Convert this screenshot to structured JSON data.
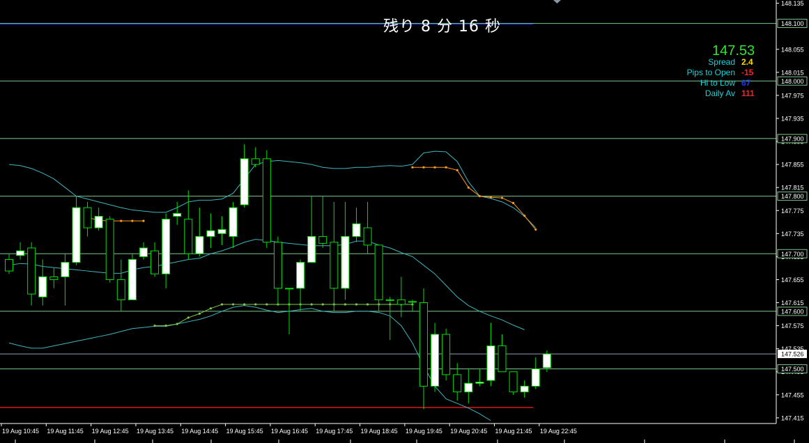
{
  "timer": {
    "text": "残り 8 分 16 秒"
  },
  "info_panel": {
    "price": "147.53",
    "rows": [
      {
        "label": "Spread",
        "value": "2.4",
        "color": "#ffd700"
      },
      {
        "label": "Pips to Open",
        "value": "-15",
        "color": "#ff2020"
      },
      {
        "label": "Hi to Low",
        "value": "67",
        "color": "#1a3cff"
      },
      {
        "label": "Daily Av",
        "value": "111",
        "color": "#ff2020"
      }
    ],
    "price_color": "#2fe52f",
    "label_color": "#18d4dc"
  },
  "chart_data": {
    "type": "candlestick",
    "timeframe_minutes": 15,
    "ylim": [
      147.41,
      148.137
    ],
    "y_ticks": [
      "148.135",
      "148.055",
      "148.015",
      "147.975",
      "147.935",
      "147.895",
      "147.855",
      "147.815",
      "147.775",
      "147.735",
      "147.695",
      "147.655",
      "147.615",
      "147.575",
      "147.535",
      "147.495",
      "147.455",
      "147.415"
    ],
    "x_labels": [
      "19 Aug 10:45",
      "19 Aug 11:45",
      "19 Aug 12:45",
      "19 Aug 13:45",
      "19 Aug 14:45",
      "19 Aug 15:45",
      "19 Aug 16:45",
      "19 Aug 17:45",
      "19 Aug 18:45",
      "19 Aug 19:45",
      "19 Aug 20:45",
      "19 Aug 21:45",
      "19 Aug 22:45"
    ],
    "horizontal_levels": [
      {
        "value": 148.1,
        "label": "148.100"
      },
      {
        "value": 148.0,
        "label": "148.000"
      },
      {
        "value": 147.9,
        "label": "147.900"
      },
      {
        "value": 147.8,
        "label": "147.800"
      },
      {
        "value": 147.7,
        "label": "147.700"
      },
      {
        "value": 147.6,
        "label": "147.600"
      },
      {
        "value": 147.5,
        "label": "147.500"
      }
    ],
    "current_price": {
      "value": 147.526,
      "label": "147.526"
    },
    "day_high": 148.1,
    "day_low": 147.433,
    "candles": [
      {
        "o": 147.69,
        "h": 147.7,
        "l": 147.665,
        "c": 147.67
      },
      {
        "o": 147.697,
        "h": 147.72,
        "l": 147.69,
        "c": 147.705
      },
      {
        "o": 147.71,
        "h": 147.72,
        "l": 147.61,
        "c": 147.63
      },
      {
        "o": 147.625,
        "h": 147.69,
        "l": 147.61,
        "c": 147.66
      },
      {
        "o": 147.66,
        "h": 147.675,
        "l": 147.64,
        "c": 147.655
      },
      {
        "o": 147.66,
        "h": 147.7,
        "l": 147.61,
        "c": 147.685
      },
      {
        "o": 147.685,
        "h": 147.8,
        "l": 147.68,
        "c": 147.78
      },
      {
        "o": 147.78,
        "h": 147.79,
        "l": 147.73,
        "c": 147.745
      },
      {
        "o": 147.745,
        "h": 147.78,
        "l": 147.74,
        "c": 147.765
      },
      {
        "o": 147.76,
        "h": 147.765,
        "l": 147.65,
        "c": 147.655
      },
      {
        "o": 147.655,
        "h": 147.69,
        "l": 147.6,
        "c": 147.62
      },
      {
        "o": 147.62,
        "h": 147.7,
        "l": 147.62,
        "c": 147.69
      },
      {
        "o": 147.695,
        "h": 147.72,
        "l": 147.69,
        "c": 147.71
      },
      {
        "o": 147.705,
        "h": 147.72,
        "l": 147.66,
        "c": 147.665
      },
      {
        "o": 147.665,
        "h": 147.77,
        "l": 147.64,
        "c": 147.76
      },
      {
        "o": 147.765,
        "h": 147.79,
        "l": 147.75,
        "c": 147.77
      },
      {
        "o": 147.76,
        "h": 147.81,
        "l": 147.69,
        "c": 147.7
      },
      {
        "o": 147.7,
        "h": 147.78,
        "l": 147.695,
        "c": 147.73
      },
      {
        "o": 147.73,
        "h": 147.77,
        "l": 147.71,
        "c": 147.74
      },
      {
        "o": 147.735,
        "h": 147.765,
        "l": 147.715,
        "c": 147.742
      },
      {
        "o": 147.73,
        "h": 147.79,
        "l": 147.71,
        "c": 147.78
      },
      {
        "o": 147.785,
        "h": 147.89,
        "l": 147.78,
        "c": 147.865
      },
      {
        "o": 147.865,
        "h": 147.885,
        "l": 147.85,
        "c": 147.855
      },
      {
        "o": 147.865,
        "h": 147.88,
        "l": 147.71,
        "c": 147.72
      },
      {
        "o": 147.72,
        "h": 147.73,
        "l": 147.61,
        "c": 147.64
      },
      {
        "o": 147.64,
        "h": 147.64,
        "l": 147.56,
        "c": 147.64
      },
      {
        "o": 147.64,
        "h": 147.69,
        "l": 147.6,
        "c": 147.685
      },
      {
        "o": 147.685,
        "h": 147.8,
        "l": 147.685,
        "c": 147.73
      },
      {
        "o": 147.73,
        "h": 147.8,
        "l": 147.71,
        "c": 147.718
      },
      {
        "o": 147.72,
        "h": 147.79,
        "l": 147.6,
        "c": 147.64
      },
      {
        "o": 147.64,
        "h": 147.79,
        "l": 147.62,
        "c": 147.73
      },
      {
        "o": 147.73,
        "h": 147.78,
        "l": 147.72,
        "c": 147.752
      },
      {
        "o": 147.745,
        "h": 147.79,
        "l": 147.7,
        "c": 147.715
      },
      {
        "o": 147.715,
        "h": 147.715,
        "l": 147.6,
        "c": 147.62
      },
      {
        "o": 147.62,
        "h": 147.625,
        "l": 147.55,
        "c": 147.62
      },
      {
        "o": 147.62,
        "h": 147.66,
        "l": 147.59,
        "c": 147.612
      },
      {
        "o": 147.617,
        "h": 147.62,
        "l": 147.6,
        "c": 147.617
      },
      {
        "o": 147.615,
        "h": 147.64,
        "l": 147.43,
        "c": 147.47
      },
      {
        "o": 147.47,
        "h": 147.58,
        "l": 147.46,
        "c": 147.56
      },
      {
        "o": 147.56,
        "h": 147.57,
        "l": 147.48,
        "c": 147.49
      },
      {
        "o": 147.49,
        "h": 147.51,
        "l": 147.445,
        "c": 147.46
      },
      {
        "o": 147.46,
        "h": 147.5,
        "l": 147.44,
        "c": 147.475
      },
      {
        "o": 147.475,
        "h": 147.5,
        "l": 147.47,
        "c": 147.477
      },
      {
        "o": 147.48,
        "h": 147.58,
        "l": 147.47,
        "c": 147.54
      },
      {
        "o": 147.54,
        "h": 147.56,
        "l": 147.5,
        "c": 147.495
      },
      {
        "o": 147.495,
        "h": 147.495,
        "l": 147.455,
        "c": 147.46
      },
      {
        "o": 147.46,
        "h": 147.48,
        "l": 147.45,
        "c": 147.47
      },
      {
        "o": 147.47,
        "h": 147.52,
        "l": 147.465,
        "c": 147.5
      },
      {
        "o": 147.502,
        "h": 147.532,
        "l": 147.495,
        "c": 147.526
      }
    ],
    "band_upper": [
      147.855,
      147.853,
      147.848,
      147.84,
      147.83,
      147.815,
      147.8,
      147.795,
      147.79,
      147.785,
      147.78,
      147.776,
      147.774,
      147.772,
      147.772,
      147.78,
      147.79,
      147.793,
      147.793,
      147.795,
      147.805,
      147.83,
      147.855,
      147.86,
      147.862,
      147.86,
      147.858,
      147.855,
      147.85,
      147.848,
      147.848,
      147.85,
      147.85,
      147.852,
      147.853,
      147.852,
      147.855,
      147.875,
      147.878,
      147.877,
      147.86,
      147.825,
      147.8,
      147.796,
      147.79,
      147.78,
      147.765,
      147.745,
      null
    ],
    "band_middle": [
      147.68,
      147.683,
      147.682,
      147.678,
      147.676,
      147.674,
      147.672,
      147.67,
      147.668,
      147.666,
      147.666,
      147.672,
      147.676,
      147.678,
      147.682,
      147.686,
      147.69,
      147.692,
      147.7,
      147.705,
      147.712,
      147.72,
      147.725,
      147.723,
      147.72,
      147.718,
      147.716,
      147.714,
      147.714,
      147.714,
      147.716,
      147.722,
      147.722,
      147.715,
      147.71,
      147.702,
      147.695,
      147.68,
      147.665,
      147.645,
      147.625,
      147.61,
      147.6,
      147.592,
      147.585,
      147.576,
      147.568,
      null,
      null
    ],
    "band_lower": [
      147.545,
      147.54,
      147.536,
      147.536,
      147.54,
      147.544,
      147.548,
      147.552,
      147.556,
      147.56,
      147.565,
      147.57,
      147.572,
      147.574,
      147.574,
      147.578,
      147.582,
      147.586,
      147.592,
      147.6,
      147.607,
      147.61,
      147.607,
      147.602,
      147.598,
      147.6,
      147.603,
      147.605,
      147.6,
      147.598,
      147.598,
      147.6,
      147.6,
      147.598,
      147.592,
      147.575,
      147.545,
      147.505,
      147.47,
      147.448,
      147.44,
      147.432,
      147.422,
      147.41,
      null,
      null,
      null,
      null,
      null
    ],
    "trail_green": [
      {
        "i": 13,
        "v": 147.575
      },
      {
        "i": 14,
        "v": 147.575
      },
      {
        "i": 15,
        "v": 147.578
      },
      {
        "i": 16,
        "v": 147.589
      },
      {
        "i": 17,
        "v": 147.596
      },
      {
        "i": 18,
        "v": 147.605
      },
      {
        "i": 19,
        "v": 147.612
      },
      {
        "i": 20,
        "v": 147.612
      },
      {
        "i": 21,
        "v": 147.612
      },
      {
        "i": 22,
        "v": 147.612
      },
      {
        "i": 23,
        "v": 147.612
      },
      {
        "i": 24,
        "v": 147.612
      },
      {
        "i": 25,
        "v": 147.612
      },
      {
        "i": 26,
        "v": 147.612
      },
      {
        "i": 27,
        "v": 147.612
      },
      {
        "i": 28,
        "v": 147.612
      },
      {
        "i": 29,
        "v": 147.612
      },
      {
        "i": 30,
        "v": 147.612
      },
      {
        "i": 31,
        "v": 147.612
      },
      {
        "i": 32,
        "v": 147.612
      },
      {
        "i": 33,
        "v": 147.612
      },
      {
        "i": 34,
        "v": 147.612
      },
      {
        "i": 35,
        "v": 147.612
      },
      {
        "i": 36,
        "v": 147.612
      }
    ],
    "trail_orange": [
      {
        "i": 7,
        "v": 147.763
      },
      {
        "i": 8,
        "v": 147.758
      },
      {
        "i": 9,
        "v": 147.757
      },
      {
        "i": 10,
        "v": 147.757
      },
      {
        "i": 11,
        "v": 147.757
      },
      {
        "i": 12,
        "v": 147.757
      },
      {
        "i": 36,
        "v": 147.85
      },
      {
        "i": 37,
        "v": 147.85
      },
      {
        "i": 38,
        "v": 147.85
      },
      {
        "i": 39,
        "v": 147.85
      },
      {
        "i": 40,
        "v": 147.845
      },
      {
        "i": 41,
        "v": 147.815
      },
      {
        "i": 42,
        "v": 147.8
      },
      {
        "i": 43,
        "v": 147.798
      },
      {
        "i": 44,
        "v": 147.797
      },
      {
        "i": 45,
        "v": 147.788
      },
      {
        "i": 46,
        "v": 147.766
      },
      {
        "i": 47,
        "v": 147.742
      }
    ],
    "colors": {
      "background": "#000000",
      "bull_body": "#ffffff",
      "bear_body": "#000000",
      "candle_outline": "#00e000",
      "band": "#3fb5c0",
      "level_line": "#7ec98a",
      "day_high_line": "#1a3cff",
      "day_low_line": "#ff2020",
      "trail_green": "#7ec84a",
      "trail_orange": "#ff9a1a",
      "axis_text": "#ffffff"
    }
  }
}
